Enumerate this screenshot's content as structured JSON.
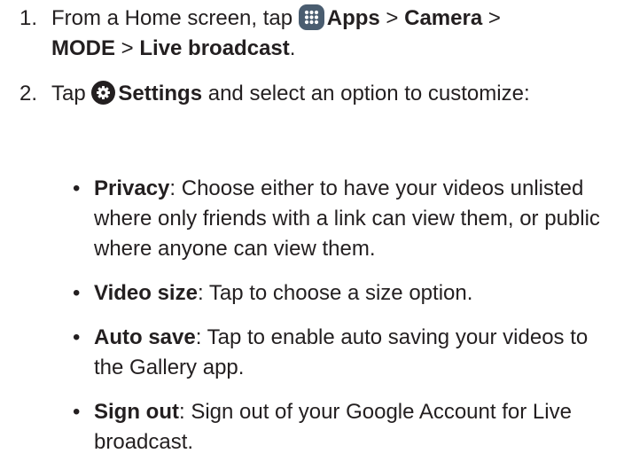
{
  "steps": [
    {
      "number": "1.",
      "prefix": "From a Home screen, tap ",
      "apps_icon": "apps-grid-icon",
      "apps_label": "Apps",
      "sep1": " > ",
      "camera_label": "Camera",
      "sep2": " > ",
      "mode_label": "MODE",
      "sep3": " > ",
      "live_label": "Live broadcast",
      "end": "."
    },
    {
      "number": "2.",
      "prefix": "Tap ",
      "settings_icon": "gear-icon",
      "settings_label": "Settings",
      "rest": " and select an option to customize:"
    }
  ],
  "options": [
    {
      "bullet": "•",
      "title": "Privacy",
      "text": ": Choose either to have your videos unlisted where only friends with a link can view them, or public where anyone can view them."
    },
    {
      "bullet": "•",
      "title": "Video size",
      "text": ": Tap to choose a size option."
    },
    {
      "bullet": "•",
      "title": "Auto save",
      "text": ": Tap to enable auto saving your videos to the Gallery app."
    },
    {
      "bullet": "•",
      "title": "Sign out",
      "text": ": Sign out of your Google Account for Live broadcast."
    }
  ],
  "colors": {
    "text": "#231f20",
    "apps_icon_bg": "#4a5d70"
  }
}
